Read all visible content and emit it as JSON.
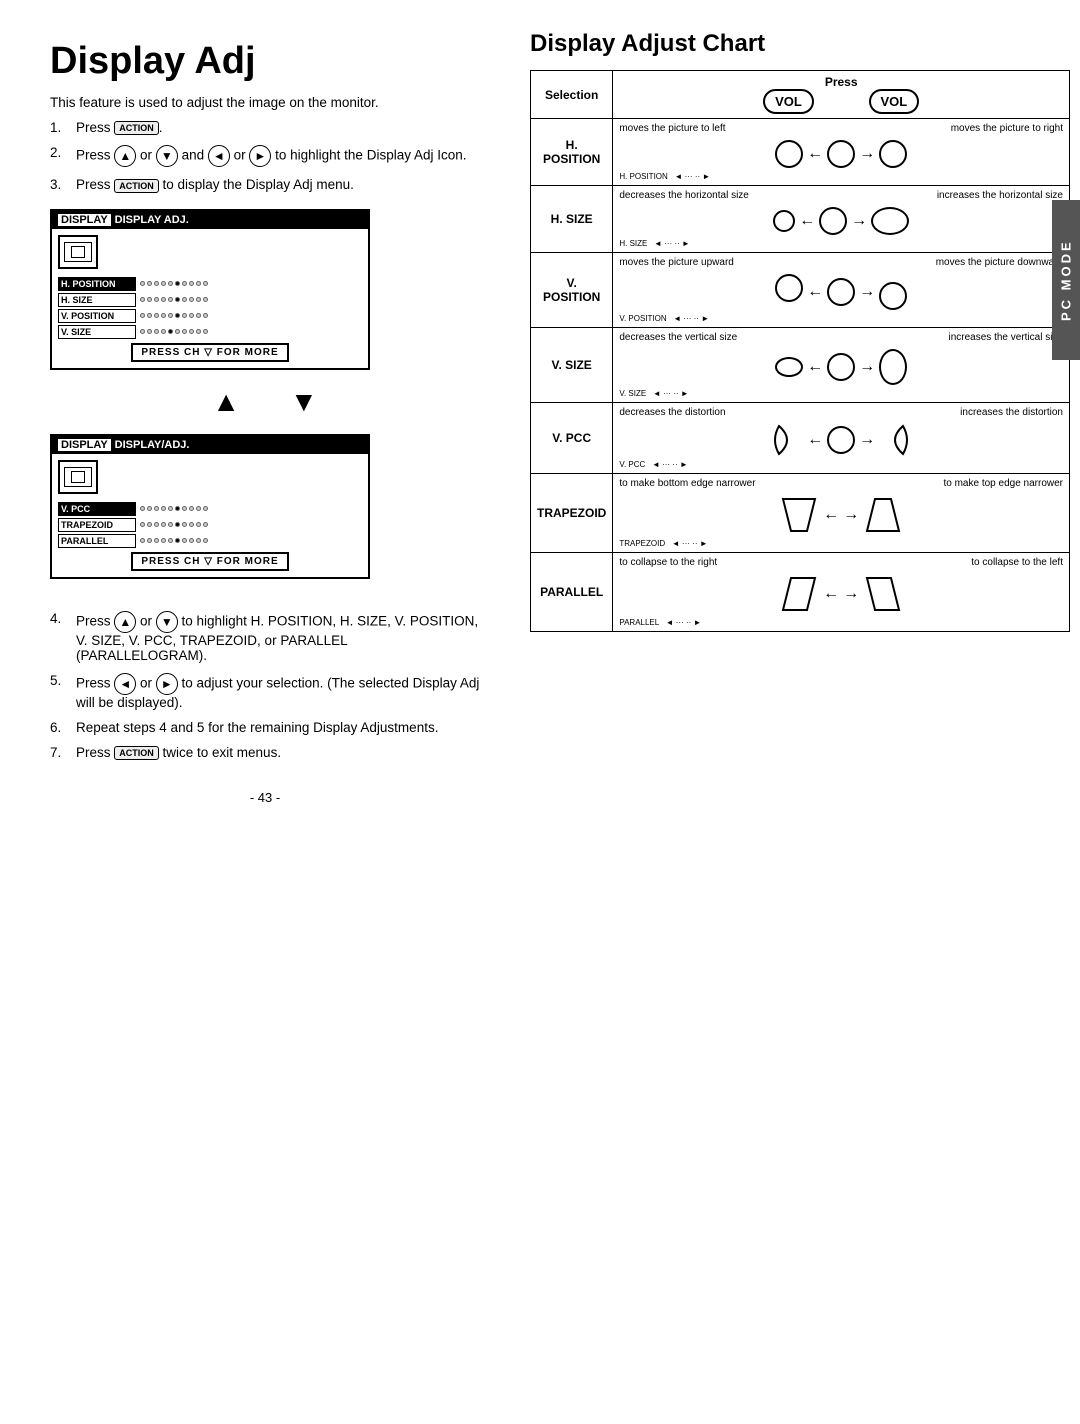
{
  "title": "Display Adj",
  "intro": "This feature is used to adjust the image on the monitor.",
  "steps": [
    {
      "num": "1.",
      "text": "Press ACTION."
    },
    {
      "num": "2.",
      "text": "Press ▲ or ▼ and ◄ or ► to highlight the Display Adj Icon."
    },
    {
      "num": "3.",
      "text": "Press ACTION to display the Display Adj menu."
    },
    {
      "num": "4.",
      "text": "Press ▲ or ▼ to highlight H. POSITION, H. SIZE, V. POSITION, V. SIZE, V. PCC, TRAPEZOID, or PARALLEL (PARALLELOGRAM)."
    },
    {
      "num": "5.",
      "text": "Press ◄ or ► to adjust your selection. (The selected Display Adj will be displayed)."
    },
    {
      "num": "6.",
      "text": "Repeat steps 4 and 5 for the remaining Display Adjustments."
    },
    {
      "num": "7.",
      "text": "Press ACTION twice to exit menus."
    }
  ],
  "osd1": {
    "header": "DISPLAY  DISPLAY ADJ.",
    "rows": [
      {
        "label": "H. POSITION",
        "selected": true
      },
      {
        "label": "H. SIZE",
        "selected": false
      },
      {
        "label": "V. POSITION",
        "selected": false
      },
      {
        "label": "V. SIZE",
        "selected": false
      }
    ],
    "press": "PRESS CH ▽ FOR MORE"
  },
  "osd2": {
    "header": "DISPLAY  DISPLAY/ADJ.",
    "rows": [
      {
        "label": "V. PCC",
        "selected": true
      },
      {
        "label": "TRAPEZOID",
        "selected": false
      },
      {
        "label": "PARALLEL",
        "selected": false
      }
    ],
    "press": "PRESS CH ▽ FOR MORE"
  },
  "chart": {
    "title": "Display Adjust Chart",
    "header": {
      "selection": "Selection",
      "press": "Press",
      "vol_left": "VOL",
      "vol_right": "VOL"
    },
    "rows": [
      {
        "label": "H. POSITION",
        "left_desc": "moves the picture to left",
        "right_desc": "moves the picture to right"
      },
      {
        "label": "H. SIZE",
        "left_desc": "decreases the horizontal size",
        "right_desc": "increases the horizontal size"
      },
      {
        "label": "V. POSITION",
        "left_desc": "moves the picture upward",
        "right_desc": "moves the picture downward"
      },
      {
        "label": "V. SIZE",
        "left_desc": "decreases the vertical size",
        "right_desc": "increases the vertical size"
      },
      {
        "label": "V. PCC",
        "left_desc": "decreases the distortion",
        "right_desc": "increases the distortion"
      },
      {
        "label": "TRAPEZOID",
        "left_desc": "to make bottom edge narrower",
        "right_desc": "to make top edge narrower"
      },
      {
        "label": "PARALLEL",
        "left_desc": "to collapse to the right",
        "right_desc": "to collapse to the left"
      }
    ]
  },
  "pc_mode_label": "PC MODE",
  "page_number": "- 43 -"
}
